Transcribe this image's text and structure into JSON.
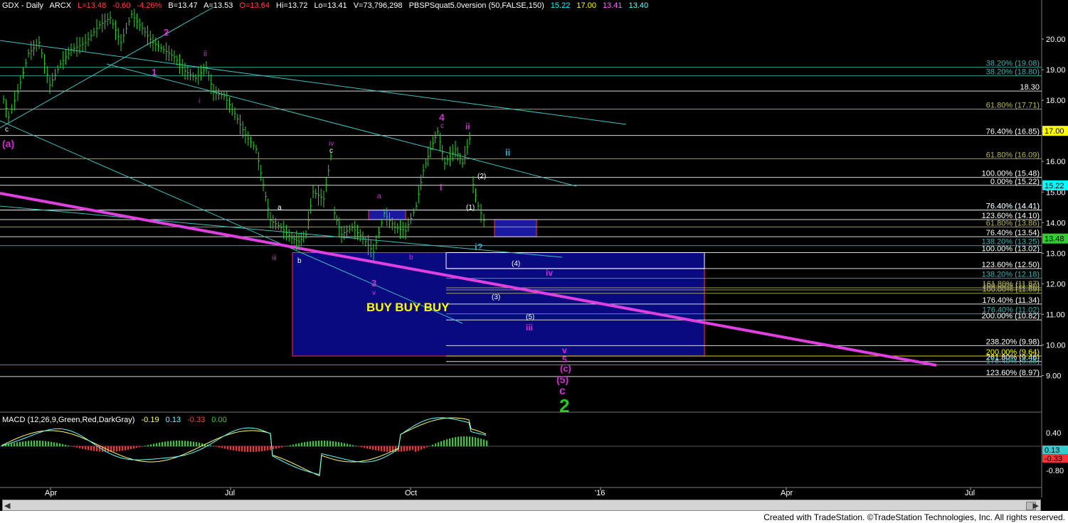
{
  "header": {
    "symbol": "GDX - Daily",
    "exchange": "ARCX",
    "last": "L=13.48",
    "change": "-0.60",
    "change_pct": "-4.26%",
    "bid": "B=13.47",
    "ask": "A=13.53",
    "open": "O=13.64",
    "high": "Hi=13.72",
    "low": "Lo=13.41",
    "volume": "V=73,796,298",
    "indicator": "PBSPSquat5.0version (50,FALSE,150)",
    "ind_v1": "15.22",
    "ind_v2": "17.00",
    "ind_v3": "13.41",
    "ind_v4": "13.40"
  },
  "macd_header": {
    "label": "MACD (12,26,9,Green,Red,DarkGray)",
    "v1": "-0.19",
    "v2": "0.13",
    "v3": "-0.33",
    "v4": "0.00"
  },
  "footer": {
    "text": "Created with TradeStation. ©TradeStation Technologies, Inc. All rights reserved."
  },
  "chart_data": {
    "type": "line",
    "ylim": [
      8.0,
      21.0
    ],
    "yticks": [
      "20.00",
      "19.00",
      "18.00",
      "17.00",
      "16.00",
      "15.00",
      "14.00",
      "13.00",
      "12.00",
      "11.00",
      "10.00",
      "9.00"
    ],
    "xlabels": [
      "Apr",
      "Jul",
      "Oct",
      "'16",
      "Apr",
      "Jul"
    ],
    "price_tags": [
      {
        "value": 17.0,
        "label": "17.00",
        "color": "#ffff00"
      },
      {
        "value": 15.22,
        "label": "15.22",
        "color": "#00ffff"
      },
      {
        "value": 13.48,
        "label": "13.48",
        "color": "#33cc33"
      }
    ],
    "levels": [
      {
        "value": 19.08,
        "label": "38.20% (19.08)",
        "color": "#40b0b0"
      },
      {
        "value": 18.8,
        "label": "38.20% (18.80)",
        "color": "#40b0b0"
      },
      {
        "value": 18.3,
        "label": "18.30",
        "color": "#ffffff"
      },
      {
        "value": 17.71,
        "label": "61.80% (17.71)",
        "color": "#b8b860"
      },
      {
        "value": 16.85,
        "label": "76.40% (16.85)",
        "color": "#ffffff"
      },
      {
        "value": 16.09,
        "label": "61.80% (16.09)",
        "color": "#b8b860"
      },
      {
        "value": 15.48,
        "label": "100.00% (15.48)",
        "color": "#ffffff"
      },
      {
        "value": 15.22,
        "label": "0.00% (15.22)",
        "color": "#ffffff"
      },
      {
        "value": 14.41,
        "label": "76.40% (14.41)",
        "color": "#40b0b0"
      },
      {
        "value": 14.41,
        "label": "76.40% (14.41)",
        "color": "#ffffff"
      },
      {
        "value": 14.1,
        "label": "123.60% (14.10)",
        "color": "#ffffff"
      },
      {
        "value": 13.86,
        "label": "61.80% (13.86)",
        "color": "#b8b860"
      },
      {
        "value": 13.54,
        "label": "76.40% (13.54)",
        "color": "#ffffff"
      },
      {
        "value": 13.25,
        "label": "138.20% (13.25)",
        "color": "#40b0b0"
      },
      {
        "value": 13.02,
        "label": "100.00% (13.02)",
        "color": "#ffffff"
      },
      {
        "value": 12.5,
        "label": "123.60% (12.50)",
        "color": "#ffffff"
      },
      {
        "value": 12.18,
        "label": "138.20% (12.18)",
        "color": "#40b0b0"
      },
      {
        "value": 11.87,
        "label": "161.80% (11.87)",
        "color": "#b8b860"
      },
      {
        "value": 11.8,
        "label": "100.00% (11.80)",
        "color": "#b8b860"
      },
      {
        "value": 11.69,
        "label": "100.00% (11.69)",
        "color": "#b8b860"
      },
      {
        "value": 11.34,
        "label": "176.40% (11.34)",
        "color": "#ffffff"
      },
      {
        "value": 11.02,
        "label": "176.40% (11.02)",
        "color": "#40b0b0"
      },
      {
        "value": 10.82,
        "label": "200.00% (10.82)",
        "color": "#ffffff"
      },
      {
        "value": 9.98,
        "label": "238.20% (9.98)",
        "color": "#ffffff"
      },
      {
        "value": 9.64,
        "label": "200.00% (9.64)",
        "color": "#ffff00"
      },
      {
        "value": 9.46,
        "label": "261.80% (9.46)",
        "color": "#ffffff"
      },
      {
        "value": 9.35,
        "label": "176.40% (9.35)",
        "color": "#40b0b0"
      },
      {
        "value": 8.97,
        "label": "123.60% (8.97)",
        "color": "#ffffff"
      }
    ],
    "wave_labels": [
      {
        "text": "(a)",
        "color": "#cc33cc"
      },
      {
        "text": "c",
        "color": "#ffffff"
      },
      {
        "text": "1",
        "color": "#cc33cc"
      },
      {
        "text": "2",
        "color": "#cc33cc"
      },
      {
        "text": "ii",
        "color": "#cc33cc"
      },
      {
        "text": "i",
        "color": "#cc33cc"
      },
      {
        "text": "iii",
        "color": "#cc33cc"
      },
      {
        "text": "a",
        "color": "#ffffff"
      },
      {
        "text": "b",
        "color": "#ffffff"
      },
      {
        "text": "iv",
        "color": "#cc33cc"
      },
      {
        "text": "c",
        "color": "#ffffff"
      },
      {
        "text": "a",
        "color": "#cc33cc"
      },
      {
        "text": "v",
        "color": "#cc33cc"
      },
      {
        "text": "3",
        "color": "#cc33cc"
      },
      {
        "text": "b",
        "color": "#cc33cc"
      },
      {
        "text": "BUY  BUY  BUY",
        "color": "#ffff00"
      },
      {
        "text": "4",
        "color": "#cc33cc"
      },
      {
        "text": "c",
        "color": "#cc33cc"
      },
      {
        "text": "ii",
        "color": "#cc33cc"
      },
      {
        "text": "i",
        "color": "#cc33cc"
      },
      {
        "text": "ii",
        "color": "#33b0d0"
      },
      {
        "text": "(2)",
        "color": "#ffffff"
      },
      {
        "text": "(1)",
        "color": "#ffffff"
      },
      {
        "text": "i?",
        "color": "#33b0d0"
      },
      {
        "text": "(4)",
        "color": "#ffffff"
      },
      {
        "text": "iv",
        "color": "#cc33cc"
      },
      {
        "text": "(3)",
        "color": "#ffffff"
      },
      {
        "text": "(5)",
        "color": "#ffffff"
      },
      {
        "text": "iii",
        "color": "#cc33cc"
      },
      {
        "text": "v",
        "color": "#cc33cc"
      },
      {
        "text": "5",
        "color": "#cc33cc"
      },
      {
        "text": "(c)",
        "color": "#cc33cc"
      },
      {
        "text": "(5)",
        "color": "#cc33cc"
      },
      {
        "text": "c",
        "color": "#cc33cc"
      },
      {
        "text": "2",
        "color": "#22cc22"
      }
    ],
    "macd": {
      "yticks": [
        "0.40",
        "0.20",
        "-0.80"
      ],
      "signal_tag": "0.13",
      "hist_tag": "-0.33"
    }
  }
}
